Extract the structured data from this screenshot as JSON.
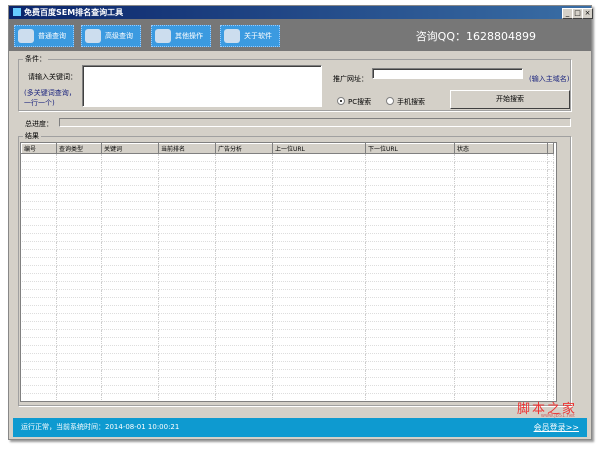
{
  "window": {
    "title": "免费百度SEM排名查询工具",
    "controls": [
      "_",
      "□",
      "×"
    ]
  },
  "toolbar": {
    "buttons": [
      {
        "label": "普通查询",
        "icon": "computer-icon"
      },
      {
        "label": "高级查询",
        "icon": "network-icon"
      },
      {
        "label": "其他操作",
        "icon": "documents-icon"
      },
      {
        "label": "关于软件",
        "icon": "printer-icon"
      }
    ],
    "contact": "咨询QQ：1628804899"
  },
  "conditions": {
    "group_label": "条件：",
    "keyword_label": "请输入关键词：",
    "keyword_hint": "(多关键词查询，一行一个)",
    "keyword_value": "",
    "url_label": "推广网址：",
    "url_value": "",
    "url_hint": "(输入主域名)",
    "radio_pc": "PC搜索",
    "radio_mobile": "手机搜索",
    "selected": "PC搜索",
    "search_button": "开始搜索"
  },
  "progress": {
    "label": "总进度：",
    "value": 0
  },
  "results": {
    "group_label": "结果",
    "columns": [
      "编号",
      "查询类型",
      "关键词",
      "当前排名",
      "广告分析",
      "上一位URL",
      "下一位URL",
      "状态"
    ],
    "rows": []
  },
  "status": {
    "text": "运行正常，当前系统时间：2014-08-01 10:00:21",
    "login_link": "会员登录>>"
  },
  "watermark": {
    "text": "脚本之家",
    "url": "www.jb51.net"
  }
}
